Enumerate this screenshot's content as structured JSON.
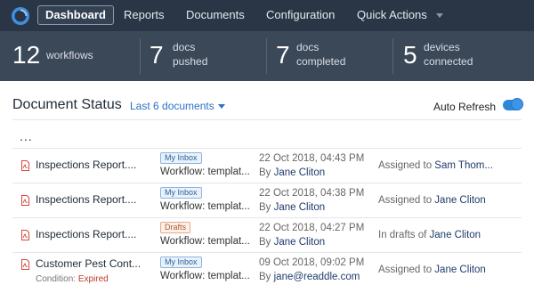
{
  "nav": {
    "items": [
      "Dashboard",
      "Reports",
      "Documents",
      "Configuration",
      "Quick Actions"
    ],
    "active": "Dashboard"
  },
  "stats": [
    {
      "value": "12",
      "label1": "workflows",
      "label2": ""
    },
    {
      "value": "7",
      "label1": "docs",
      "label2": "pushed"
    },
    {
      "value": "7",
      "label1": "docs",
      "label2": "completed"
    },
    {
      "value": "5",
      "label1": "devices",
      "label2": "connected"
    }
  ],
  "section": {
    "title": "Document Status",
    "filter": "Last 6 documents",
    "auto_refresh_label": "Auto Refresh",
    "auto_refresh_on": true,
    "more": "..."
  },
  "rows": [
    {
      "name": "Inspections Report....",
      "condition_label": "",
      "condition_value": "",
      "badge": "My Inbox",
      "workflow": "Workflow: templat...",
      "date": "22 Oct 2018, 04:43 PM",
      "by_prefix": "By ",
      "by": "Jane Cliton",
      "assign_prefix": "Assigned to ",
      "assign_to": "Sam Thom..."
    },
    {
      "name": "Inspections Report....",
      "condition_label": "",
      "condition_value": "",
      "badge": "My Inbox",
      "workflow": "Workflow: templat...",
      "date": "22 Oct 2018, 04:38 PM",
      "by_prefix": "By ",
      "by": "Jane Cliton",
      "assign_prefix": "Assigned to ",
      "assign_to": "Jane Cliton"
    },
    {
      "name": "Inspections Report....",
      "condition_label": "",
      "condition_value": "",
      "badge": "Drafts",
      "workflow": "Workflow: templat...",
      "date": "22 Oct 2018, 04:27 PM",
      "by_prefix": "By ",
      "by": "Jane Cliton",
      "assign_prefix": "In drafts of ",
      "assign_to": "Jane Cliton"
    },
    {
      "name": "Customer Pest Cont...",
      "condition_label": "Condition: ",
      "condition_value": "Expired",
      "badge": "My Inbox",
      "workflow": "Workflow: templat...",
      "date": "09 Oct 2018, 09:02 PM",
      "by_prefix": "By ",
      "by": "jane@readdle.com",
      "assign_prefix": "Assigned to ",
      "assign_to": "Jane Cliton"
    }
  ],
  "colors": {
    "nav_bg": "#2a3645",
    "stats_bg": "#3b4858",
    "accent": "#2a73c9",
    "expired": "#c0392b"
  },
  "icons": [
    "app-logo-icon",
    "chevron-down-icon",
    "pdf-file-icon"
  ]
}
